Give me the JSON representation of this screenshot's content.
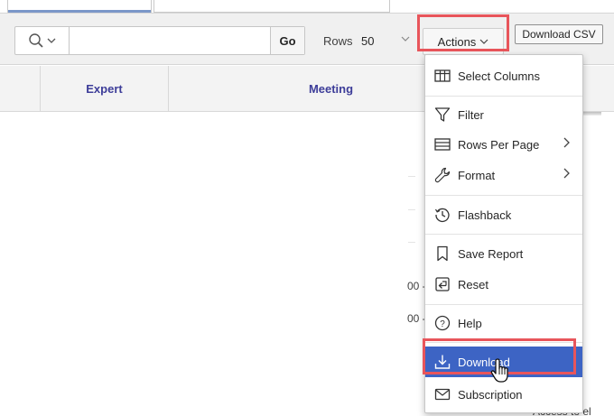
{
  "toolbar": {
    "go_label": "Go",
    "rows_label": "Rows",
    "rows_value": "50",
    "actions_label": "Actions",
    "download_csv_label": "Download CSV",
    "search_value": "",
    "search_placeholder": ""
  },
  "table": {
    "columns": [
      "Expert",
      "Meeting"
    ],
    "row_fragments": [
      "00 -",
      "00 -"
    ],
    "trailing_text": "Access to el"
  },
  "actions_menu": {
    "items": [
      {
        "label": "Select Columns",
        "icon": "columns-icon",
        "submenu": false
      },
      {
        "label": "Filter",
        "icon": "filter-icon",
        "submenu": false
      },
      {
        "label": "Rows Per Page",
        "icon": "rows-icon",
        "submenu": true
      },
      {
        "label": "Format",
        "icon": "wrench-icon",
        "submenu": true
      },
      {
        "label": "Flashback",
        "icon": "history-icon",
        "submenu": false
      },
      {
        "label": "Save Report",
        "icon": "bookmark-icon",
        "submenu": false
      },
      {
        "label": "Reset",
        "icon": "undo-icon",
        "submenu": false
      },
      {
        "label": "Help",
        "icon": "help-icon",
        "submenu": false
      },
      {
        "label": "Download",
        "icon": "download-icon",
        "submenu": false,
        "active": true
      },
      {
        "label": "Subscription",
        "icon": "mail-icon",
        "submenu": false
      }
    ]
  },
  "colors": {
    "accent": "#3d64c4",
    "highlight": "#e8555b",
    "header_text": "#3d3d99"
  }
}
